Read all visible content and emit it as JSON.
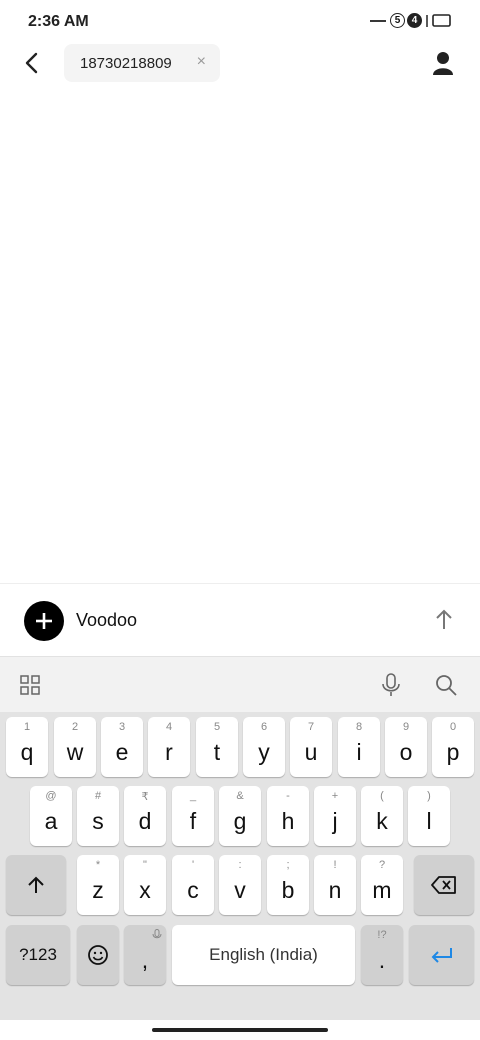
{
  "status": {
    "time": "2:36 AM",
    "notif_a": "5",
    "notif_b": "4"
  },
  "header": {
    "recipient": "18730218809",
    "clear": "×"
  },
  "compose": {
    "message": "Voodoo"
  },
  "keyboard": {
    "row1": [
      {
        "k": "q",
        "h": "1"
      },
      {
        "k": "w",
        "h": "2"
      },
      {
        "k": "e",
        "h": "3"
      },
      {
        "k": "r",
        "h": "4"
      },
      {
        "k": "t",
        "h": "5"
      },
      {
        "k": "y",
        "h": "6"
      },
      {
        "k": "u",
        "h": "7"
      },
      {
        "k": "i",
        "h": "8"
      },
      {
        "k": "o",
        "h": "9"
      },
      {
        "k": "p",
        "h": "0"
      }
    ],
    "row2": [
      {
        "k": "a",
        "h": "@"
      },
      {
        "k": "s",
        "h": "#"
      },
      {
        "k": "d",
        "h": "₹"
      },
      {
        "k": "f",
        "h": "_"
      },
      {
        "k": "g",
        "h": "&"
      },
      {
        "k": "h",
        "h": "-"
      },
      {
        "k": "j",
        "h": "+"
      },
      {
        "k": "k",
        "h": "("
      },
      {
        "k": "l",
        "h": ")"
      }
    ],
    "row3": [
      {
        "k": "z",
        "h": "*"
      },
      {
        "k": "x",
        "h": "\""
      },
      {
        "k": "c",
        "h": "'"
      },
      {
        "k": "v",
        "h": ":"
      },
      {
        "k": "b",
        "h": ";"
      },
      {
        "k": "n",
        "h": "!"
      },
      {
        "k": "m",
        "h": "?"
      }
    ],
    "symbols": "?123",
    "comma": ",",
    "space": "English (India)",
    "period": ".",
    "period_hint": "!?"
  }
}
